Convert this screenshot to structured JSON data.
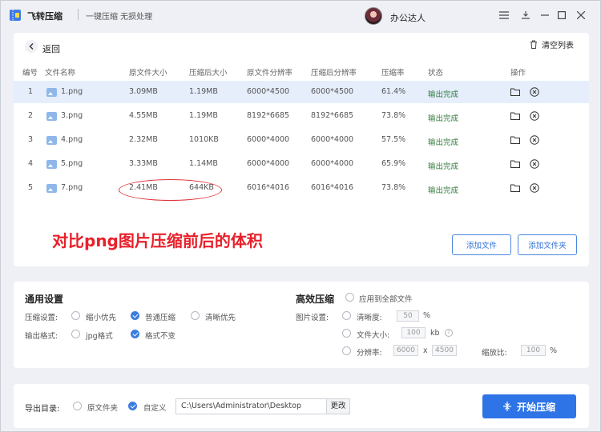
{
  "app": {
    "title": "飞转压缩",
    "subtitle": "一键压缩 无损处理",
    "user_name": "办公达人"
  },
  "toolbar": {
    "back_label": "返回",
    "clear_label": "清空列表"
  },
  "table": {
    "columns": [
      "编号",
      "文件名称",
      "原文件大小",
      "压缩后大小",
      "原文件分辨率",
      "压缩后分辨率",
      "压缩率",
      "状态",
      "操作"
    ],
    "rows": [
      {
        "id": "1",
        "name": "1.png",
        "orig_size": "3.09MB",
        "new_size": "1.19MB",
        "orig_res": "6000*4500",
        "new_res": "6000*4500",
        "ratio": "61.4%",
        "status": "输出完成"
      },
      {
        "id": "2",
        "name": "3.png",
        "orig_size": "4.55MB",
        "new_size": "1.19MB",
        "orig_res": "8192*6685",
        "new_res": "8192*6685",
        "ratio": "73.8%",
        "status": "输出完成"
      },
      {
        "id": "3",
        "name": "4.png",
        "orig_size": "2.32MB",
        "new_size": "1010KB",
        "orig_res": "6000*4000",
        "new_res": "6000*4000",
        "ratio": "57.5%",
        "status": "输出完成"
      },
      {
        "id": "4",
        "name": "5.png",
        "orig_size": "3.33MB",
        "new_size": "1.14MB",
        "orig_res": "6000*4000",
        "new_res": "6000*4000",
        "ratio": "65.9%",
        "status": "输出完成"
      },
      {
        "id": "5",
        "name": "7.png",
        "orig_size": "2.41MB",
        "new_size": "644KB",
        "orig_res": "6016*4016",
        "new_res": "6016*4016",
        "ratio": "73.8%",
        "status": "输出完成"
      }
    ]
  },
  "annotation": {
    "caption": "对比png图片压缩前后的体积"
  },
  "file_actions": {
    "add_file": "添加文件",
    "add_folder": "添加文件夹"
  },
  "general_settings": {
    "title": "通用设置",
    "compress_label": "压缩设置:",
    "compress_options": [
      "缩小优先",
      "普通压缩",
      "清晰优先"
    ],
    "compress_selected": "普通压缩",
    "format_label": "输出格式:",
    "format_options": [
      "jpg格式",
      "格式不变"
    ],
    "format_selected": "格式不变"
  },
  "advanced": {
    "title": "高效压缩",
    "apply_all": "应用到全部文件",
    "image_setting_label": "图片设置:",
    "clarity_label": "清晰度:",
    "clarity_value": "50",
    "clarity_unit": "%",
    "filesize_label": "文件大小:",
    "filesize_value": "100",
    "filesize_unit": "kb",
    "resolution_label": "分辨率:",
    "res_w": "6000",
    "res_x": "x",
    "res_h": "4500",
    "scale_label": "缩放比:",
    "scale_value": "100",
    "scale_unit": "%"
  },
  "output": {
    "label": "导出目录:",
    "opt_original": "原文件夹",
    "opt_custom": "自定义",
    "path": "C:\\Users\\Administrator\\Desktop",
    "change": "更改",
    "start": "开始压缩"
  },
  "colors": {
    "accent": "#2e74e6",
    "status_done": "#2f7a3b",
    "annotation_red": "#e8202a",
    "row_selected": "#e6eefc"
  }
}
